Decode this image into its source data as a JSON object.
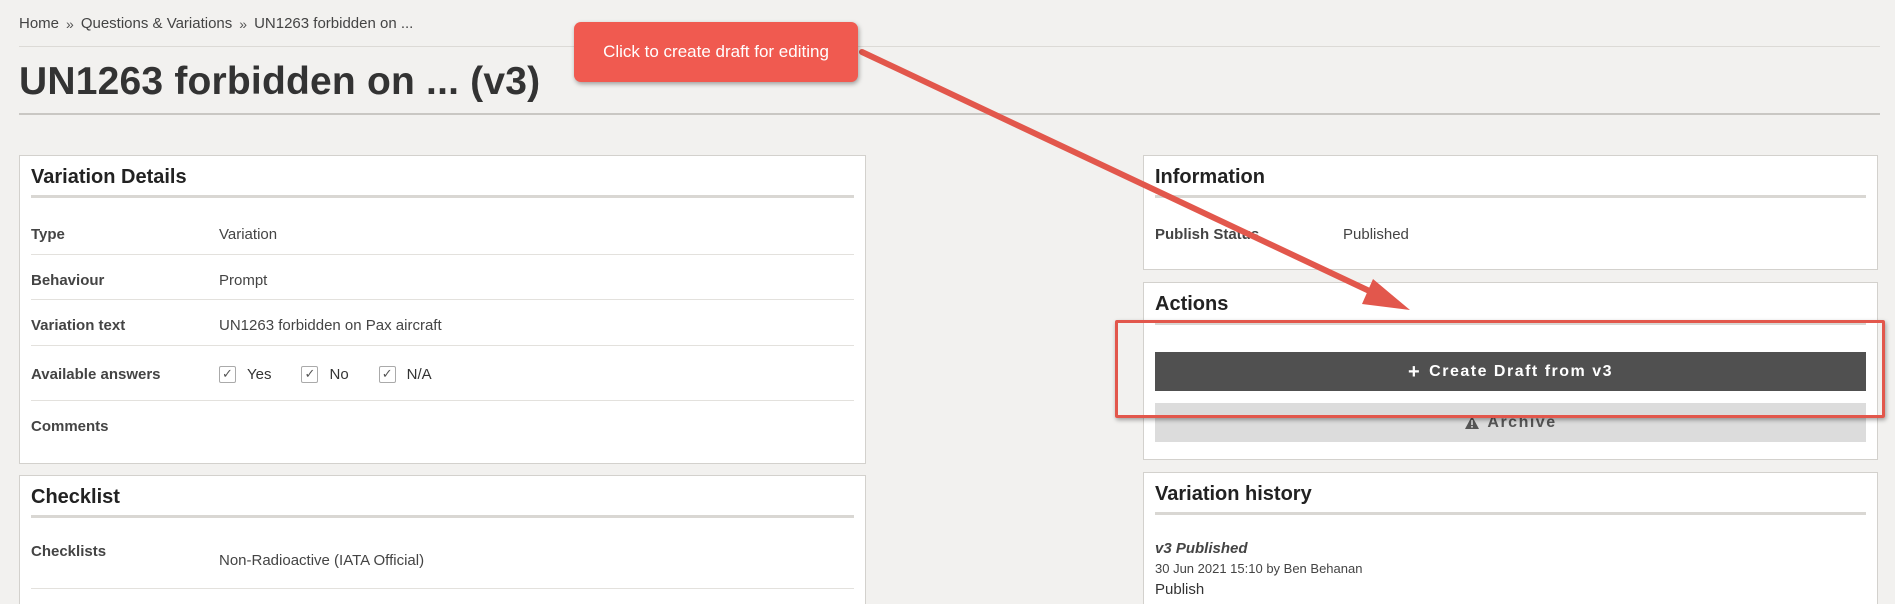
{
  "breadcrumb": {
    "items": [
      "Home",
      "Questions & Variations",
      "UN1263 forbidden on ..."
    ],
    "separator": "»"
  },
  "page": {
    "title": "UN1263 forbidden on ... (v3)"
  },
  "variation_details": {
    "heading": "Variation Details",
    "rows": [
      {
        "label": "Type",
        "value": "Variation"
      },
      {
        "label": "Behaviour",
        "value": "Prompt"
      },
      {
        "label": "Variation text",
        "value": "UN1263 forbidden on Pax aircraft"
      },
      {
        "label": "Available answers",
        "answers": [
          "Yes",
          "No",
          "N/A"
        ]
      },
      {
        "label": "Comments",
        "value": ""
      }
    ]
  },
  "checklist": {
    "heading": "Checklist",
    "rows": [
      {
        "label": "Checklists",
        "value": "Non-Radioactive (IATA Official)"
      }
    ]
  },
  "information": {
    "heading": "Information",
    "rows": [
      {
        "label": "Publish Status",
        "value": "Published"
      }
    ]
  },
  "actions": {
    "heading": "Actions",
    "create_draft_label": "Create Draft from v3",
    "archive_label": "Archive"
  },
  "history": {
    "heading": "Variation history",
    "entries": [
      {
        "title": "v3 Published",
        "meta": "30 Jun 2021 15:10 by Ben Behanan",
        "action": "Publish"
      }
    ]
  },
  "annotation": {
    "tooltip_text": "Click to create draft for editing",
    "color": "#e2574c"
  },
  "colors": {
    "background": "#f2f1ef",
    "primary_button": "#505050",
    "disabled_button": "#dcdcdc",
    "accent": "#f05a50"
  }
}
